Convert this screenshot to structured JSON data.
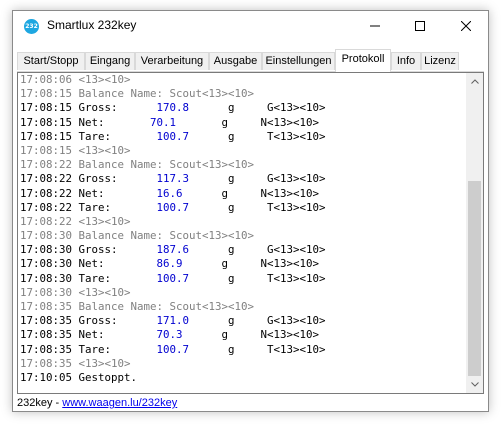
{
  "window": {
    "title": "Smartlux 232key",
    "icon_label": "232 key"
  },
  "tabs": [
    {
      "label": "Start/Stopp",
      "active": false
    },
    {
      "label": "Eingang",
      "active": false
    },
    {
      "label": "Verarbeitung",
      "active": false
    },
    {
      "label": "Ausgabe",
      "active": false
    },
    {
      "label": "Einstellungen",
      "active": false
    },
    {
      "label": "Protokoll",
      "active": true
    },
    {
      "label": "Info",
      "active": false
    },
    {
      "label": "Lizenz",
      "active": false
    }
  ],
  "log": [
    {
      "style": "muted",
      "time": "17:08:06",
      "text": " <13><10>"
    },
    {
      "style": "muted",
      "time": "17:08:15",
      "text": " Balance Name: Scout<13><10>"
    },
    {
      "style": "normal",
      "time": "17:08:15",
      "label": " Gross:      ",
      "value": "170.8",
      "rest": "      g     G<13><10>"
    },
    {
      "style": "normal",
      "time": "17:08:15",
      "label": " Net:       ",
      "value": "70.1",
      "rest": "       g     N<13><10>"
    },
    {
      "style": "normal",
      "time": "17:08:15",
      "label": " Tare:       ",
      "value": "100.7",
      "rest": "      g     T<13><10>"
    },
    {
      "style": "muted",
      "time": "17:08:15",
      "text": " <13><10>"
    },
    {
      "style": "muted",
      "time": "17:08:22",
      "text": " Balance Name: Scout<13><10>"
    },
    {
      "style": "normal",
      "time": "17:08:22",
      "label": " Gross:      ",
      "value": "117.3",
      "rest": "      g     G<13><10>"
    },
    {
      "style": "normal",
      "time": "17:08:22",
      "label": " Net:        ",
      "value": "16.6",
      "rest": "      g     N<13><10>"
    },
    {
      "style": "normal",
      "time": "17:08:22",
      "label": " Tare:       ",
      "value": "100.7",
      "rest": "      g     T<13><10>"
    },
    {
      "style": "muted",
      "time": "17:08:22",
      "text": " <13><10>"
    },
    {
      "style": "muted",
      "time": "17:08:30",
      "text": " Balance Name: Scout<13><10>"
    },
    {
      "style": "normal",
      "time": "17:08:30",
      "label": " Gross:      ",
      "value": "187.6",
      "rest": "      g     G<13><10>"
    },
    {
      "style": "normal",
      "time": "17:08:30",
      "label": " Net:        ",
      "value": "86.9",
      "rest": "      g     N<13><10>"
    },
    {
      "style": "normal",
      "time": "17:08:30",
      "label": " Tare:       ",
      "value": "100.7",
      "rest": "      g     T<13><10>"
    },
    {
      "style": "muted",
      "time": "17:08:30",
      "text": " <13><10>"
    },
    {
      "style": "muted",
      "time": "17:08:35",
      "text": " Balance Name: Scout<13><10>"
    },
    {
      "style": "normal",
      "time": "17:08:35",
      "label": " Gross:      ",
      "value": "171.0",
      "rest": "      g     G<13><10>"
    },
    {
      "style": "normal",
      "time": "17:08:35",
      "label": " Net:        ",
      "value": "70.3",
      "rest": "      g     N<13><10>"
    },
    {
      "style": "normal",
      "time": "17:08:35",
      "label": " Tare:       ",
      "value": "100.7",
      "rest": "      g     T<13><10>"
    },
    {
      "style": "muted",
      "time": "17:08:35",
      "text": " <13><10>"
    },
    {
      "style": "normal",
      "time": "17:10:05",
      "text": " Gestoppt."
    }
  ],
  "status": {
    "prefix": "232key - ",
    "link": "www.waagen.lu/232key"
  },
  "colors": {
    "value_blue": "#0000d0",
    "muted_gray": "#808080",
    "icon_blue": "#1ea7e1"
  }
}
